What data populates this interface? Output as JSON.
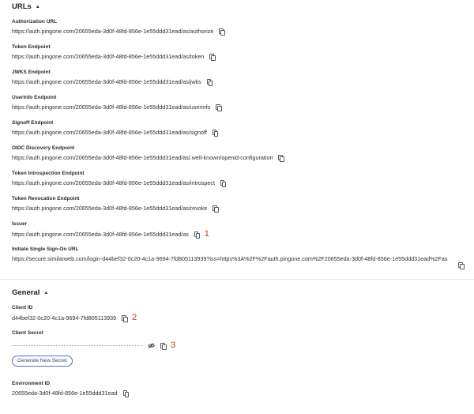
{
  "urls": {
    "title": "URLs",
    "fields": [
      {
        "label": "Authorization URL",
        "value": "https://auth.pingone.com/20655eda-3d0f-48fd-856e-1e55ddd31ead/as/authorize"
      },
      {
        "label": "Token Endpoint",
        "value": "https://auth.pingone.com/20655eda-3d0f-48fd-856e-1e55ddd31ead/as/token"
      },
      {
        "label": "JWKS Endpoint",
        "value": "https://auth.pingone.com/20655eda-3d0f-48fd-856e-1e55ddd31ead/as/jwks"
      },
      {
        "label": "UserInfo Endpoint",
        "value": "https://auth.pingone.com/20655eda-3d0f-48fd-856e-1e55ddd31ead/as/userinfo"
      },
      {
        "label": "Signoff Endpoint",
        "value": "https://auth.pingone.com/20655eda-3d0f-48fd-856e-1e55ddd31ead/as/signoff"
      },
      {
        "label": "OIDC Discovery Endpoint",
        "value": "https://auth.pingone.com/20655eda-3d0f-48fd-856e-1e55ddd31ead/as/.well-known/openid-configuration"
      },
      {
        "label": "Token Introspection Endpoint",
        "value": "https://auth.pingone.com/20655eda-3d0f-48fd-856e-1e55ddd31ead/as/introspect"
      },
      {
        "label": "Token Revocation Endpoint",
        "value": "https://auth.pingone.com/20655eda-3d0f-48fd-856e-1e55ddd31ead/as/revoke"
      },
      {
        "label": "Issuer",
        "value": "https://auth.pingone.com/20655eda-3d0f-48fd-856e-1e55ddd31ead/as",
        "marker": "1"
      },
      {
        "label": "Initiate Single Sign-On URL",
        "value": "https://secure.similarweb.com/login-d44bef32-0c20-4c1a-9694-7fd805113939?iss=https%3A%2F%2Fauth.pingone.com%2F20655eda-3d0f-48fd-856e-1e55ddd31ead%2Fas"
      }
    ]
  },
  "general": {
    "title": "General",
    "client_id_label": "Client ID",
    "client_id_value": "d44bef32-0c20-4c1a-9694-7fd805113939",
    "client_id_marker": "2",
    "client_secret_label": "Client Secret",
    "client_secret_marker": "3",
    "generate_button": "Generate New Secret",
    "environment_id_label": "Environment ID",
    "environment_id_value": "20655eda-3d0f-48fd-856e-1e55ddd31ead"
  },
  "colors": {
    "marker": "#d0341f",
    "button_border": "#5c6bc0"
  }
}
